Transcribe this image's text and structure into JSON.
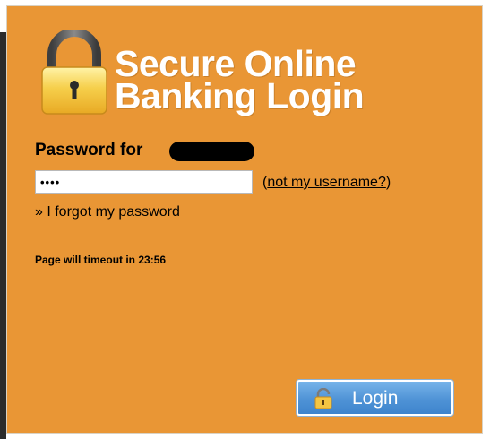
{
  "header": {
    "title_line1": "Secure Online",
    "title_line2": "Banking Login"
  },
  "form": {
    "password_label": "Password for",
    "password_value": "••••",
    "not_me_open": "(",
    "not_me_link": "not my username?",
    "not_me_close": ")",
    "forgot_link": "» I forgot my password",
    "timeout_text": "Page will timeout in 23:56"
  },
  "login_button": {
    "label": "Login",
    "icon": "padlock-icon"
  },
  "colors": {
    "panel_background": "#e99635",
    "title_text": "#ffffff",
    "button_blue": "#4f93d6",
    "lock_gold": "#f4c542",
    "lock_shackle": "#555555"
  },
  "icons": {
    "header": "padlock-icon"
  }
}
